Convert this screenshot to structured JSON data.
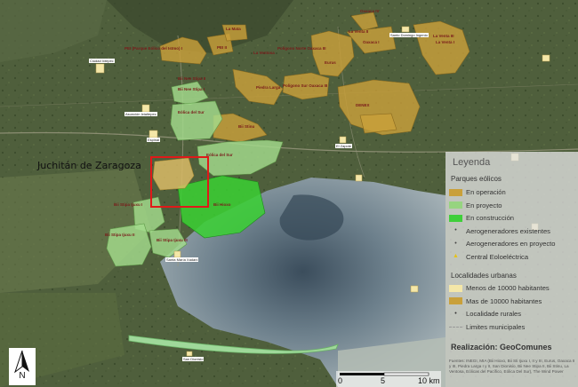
{
  "map": {
    "city_label": "Juchitán de Zaragoza",
    "wind_parks": [
      "PEI (Parque Eólico del Istmo) I",
      "PEI II",
      "La Mata",
      "Oaxaca IV",
      "La Venta II",
      "La Venta III",
      "Santo Domingo",
      "Oaxaca I",
      "La Venta I",
      "Polígono Norte Oaxaca III",
      "Eurus",
      "La Ventosa",
      "Bii Nee Stipa II",
      "Polígono Sur Oaxaca III",
      "Bii Nee Stipa I",
      "Piedra Larga",
      "Eólica del Sur",
      "Bii Stinu",
      "DENEX",
      "Bii Hioxo",
      "Bii Stipa Ijuxu I",
      "Bii Stipa Ijuxu II",
      "Bii Stipa Ijuxu III"
    ],
    "towns": [
      "Ciudad Ixtepec",
      "Asunción Ixtaltepec",
      "Espinal",
      "Santo Domingo Ingenio",
      "El Zapote",
      "Santa María Xadani",
      "San Dionisio"
    ]
  },
  "legend": {
    "title": "Leyenda",
    "section_parks": "Parques eólicos",
    "items_parks": [
      {
        "label": "En operación",
        "color": "#c9a03a",
        "kind": "swatch"
      },
      {
        "label": "En proyecto",
        "color": "#96d480",
        "kind": "swatch"
      },
      {
        "label": "En construcción",
        "color": "#3fcf3a",
        "kind": "swatch"
      },
      {
        "label": "Aerogeneradores existentes",
        "color": "#444444",
        "kind": "dot"
      },
      {
        "label": "Aerogeneradores en proyecto",
        "color": "#444444",
        "kind": "dot"
      },
      {
        "label": "Central Eoloeléctrica",
        "color": "#e6c21a",
        "kind": "triangle"
      }
    ],
    "section_towns": "Localidades urbanas",
    "items_towns": [
      {
        "label": "Menos de 10000 habitantes",
        "color": "#f4e7a8",
        "kind": "swatch"
      },
      {
        "label": "Mas de 10000 habitantes",
        "color": "#c9a03a",
        "kind": "swatch"
      },
      {
        "label": "Localidade rurales",
        "color": "#333333",
        "kind": "dot"
      },
      {
        "label": "Limites municipales",
        "color": "#999999",
        "kind": "line"
      }
    ],
    "credit": "Realización: GeoComunes",
    "sources": "Fuentes: INEGI, MIA (Bii Hioxo, Bii Sti Ijuxu I, II y III, Eurus, Oaxaca II y III, Piedra Larga I y II, San Dionisio, Bii Nee Stipa II, Bii Stinu, La Ventosa, Eólicas del Pacífico, Eólica Del Sur), The Wind Power"
  },
  "scale": {
    "ticks": [
      "0",
      "5",
      "10 km"
    ]
  },
  "north_arrow": {
    "label": "N"
  }
}
